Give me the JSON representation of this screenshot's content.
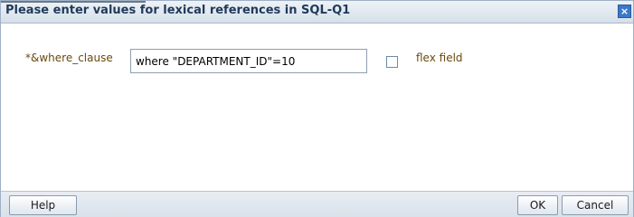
{
  "dialog": {
    "title": "Please enter values for lexical references in SQL-Q1",
    "close_icon": "close-icon"
  },
  "form": {
    "field_label": "*&where_clause",
    "field_value": "where \"DEPARTMENT_ID\"=10",
    "checkbox_checked": false,
    "checkbox_label": "flex field"
  },
  "footer": {
    "help_label": "Help",
    "ok_label": "OK",
    "cancel_label": "Cancel"
  },
  "colors": {
    "label_color": "#6a4a0c",
    "title_color": "#1f3a5a",
    "accent": "#3c78c8"
  }
}
